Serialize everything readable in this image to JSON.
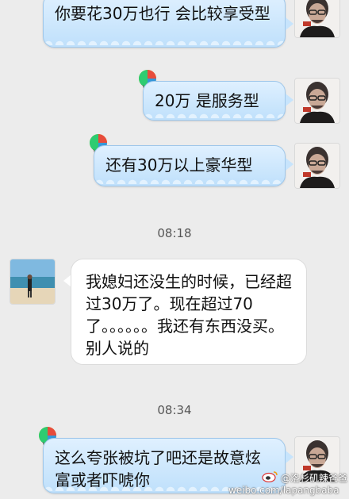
{
  "messages": [
    {
      "side": "right",
      "text": "你要花30万也行 会比较享受型"
    },
    {
      "side": "right",
      "text": "20万 是服务型"
    },
    {
      "side": "right",
      "text": "还有30万以上豪华型"
    },
    {
      "side": "time",
      "text": "08:18"
    },
    {
      "side": "left",
      "text": "我媳妇还没生的时候，已经超过30万了。现在超过70了。。。。。。我还有东西没买。别人说的"
    },
    {
      "side": "time",
      "text": "08:34"
    },
    {
      "side": "right",
      "text": "这么夸张被坑了吧还是故意炫富或者吓唬你"
    }
  ],
  "watermark": {
    "handle": "@洛杉矶辣爸爸",
    "url": "weibo.com/lapangbaba"
  },
  "colors": {
    "background": "#ececec",
    "blue_bubble": "#c7e4fc",
    "white_bubble": "#ffffff"
  },
  "icons": {
    "balloon": "hot-air-balloon-icon",
    "weibo": "weibo-logo-icon"
  }
}
